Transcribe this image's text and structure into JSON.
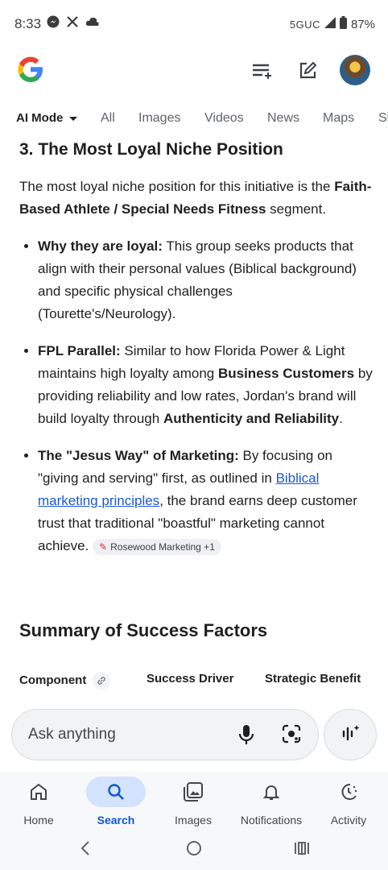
{
  "status": {
    "time": "8:33",
    "network": "5GUC",
    "battery": "87%"
  },
  "tabs": [
    {
      "label": "AI Mode"
    },
    {
      "label": "All"
    },
    {
      "label": "Images"
    },
    {
      "label": "Videos"
    },
    {
      "label": "News"
    },
    {
      "label": "Maps"
    },
    {
      "label": "Sh"
    }
  ],
  "article": {
    "heading": "3. The Most Loyal Niche Position",
    "intro_pre": "The most loyal niche position for this initiative is the ",
    "intro_bold": "Faith-Based Athlete / Special Needs Fitness",
    "intro_post": " segment.",
    "bullets": [
      {
        "title": "Why they are loyal:",
        "text": " This group seeks products that align with their personal values (Biblical background) and specific physical challenges (Tourette's/Neurology)."
      },
      {
        "title": "FPL Parallel:",
        "text_a": " Similar to how Florida Power & Light maintains high loyalty among ",
        "bold_a": "Business Customers",
        "text_b": " by providing reliability and low rates, Jordan's brand will build loyalty through ",
        "bold_b": "Authenticity and Reliability",
        "text_c": "."
      },
      {
        "title": "The \"Jesus Way\" of Marketing:",
        "text_a": " By focusing on \"giving and serving\" first, as outlined in ",
        "link": "Biblical marketing principles",
        "text_b": ", the brand earns deep customer trust that traditional \"boastful\" marketing cannot achieve.",
        "chip": "Rosewood Marketing +1"
      }
    ],
    "summary_heading": "Summary of Success Factors",
    "table_headers": [
      "Component",
      "Success Driver",
      "Strategic Benefit"
    ]
  },
  "ask": {
    "placeholder": "Ask anything"
  },
  "bottom_nav": [
    {
      "label": "Home"
    },
    {
      "label": "Search"
    },
    {
      "label": "Images"
    },
    {
      "label": "Notifications"
    },
    {
      "label": "Activity"
    }
  ],
  "colors": {
    "accent": "#0b57d0",
    "link": "#1a57d2",
    "active_pill": "#d3e3fd"
  }
}
